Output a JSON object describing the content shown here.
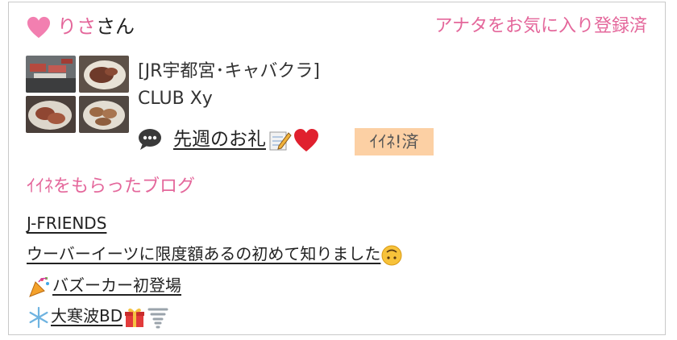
{
  "user": {
    "name": "りさ",
    "suffix": "さん",
    "favorite_status": "アナタをお気に入り登録済"
  },
  "shop": {
    "area": "[JR宇都宮･キャバクラ]",
    "name": "CLUB Xy"
  },
  "post": {
    "title": "先週のお礼",
    "title_emojis": [
      "memo-emoji",
      "red-heart-emoji"
    ],
    "iine_badge": "ｲｲﾈ!済"
  },
  "blogs": {
    "section_title": "ｲｲﾈをもらったブログ",
    "items": [
      {
        "text": "J-FRIENDS"
      },
      {
        "text": "ウーバーイーツに限度額あるの初めて知りました",
        "trailing_emoji": "upside-down-face-emoji"
      },
      {
        "leading_emoji": "party-popper-emoji",
        "text": "バズーカー初登場"
      },
      {
        "leading_emoji": "snowflake-emoji",
        "text": "大寒波BD",
        "trailing_emoji": "gift-emoji tornado-emoji"
      }
    ]
  },
  "colors": {
    "accent_pink": "#e4679b",
    "badge_bg": "#fcd0a4",
    "border": "#c9c9c9"
  }
}
